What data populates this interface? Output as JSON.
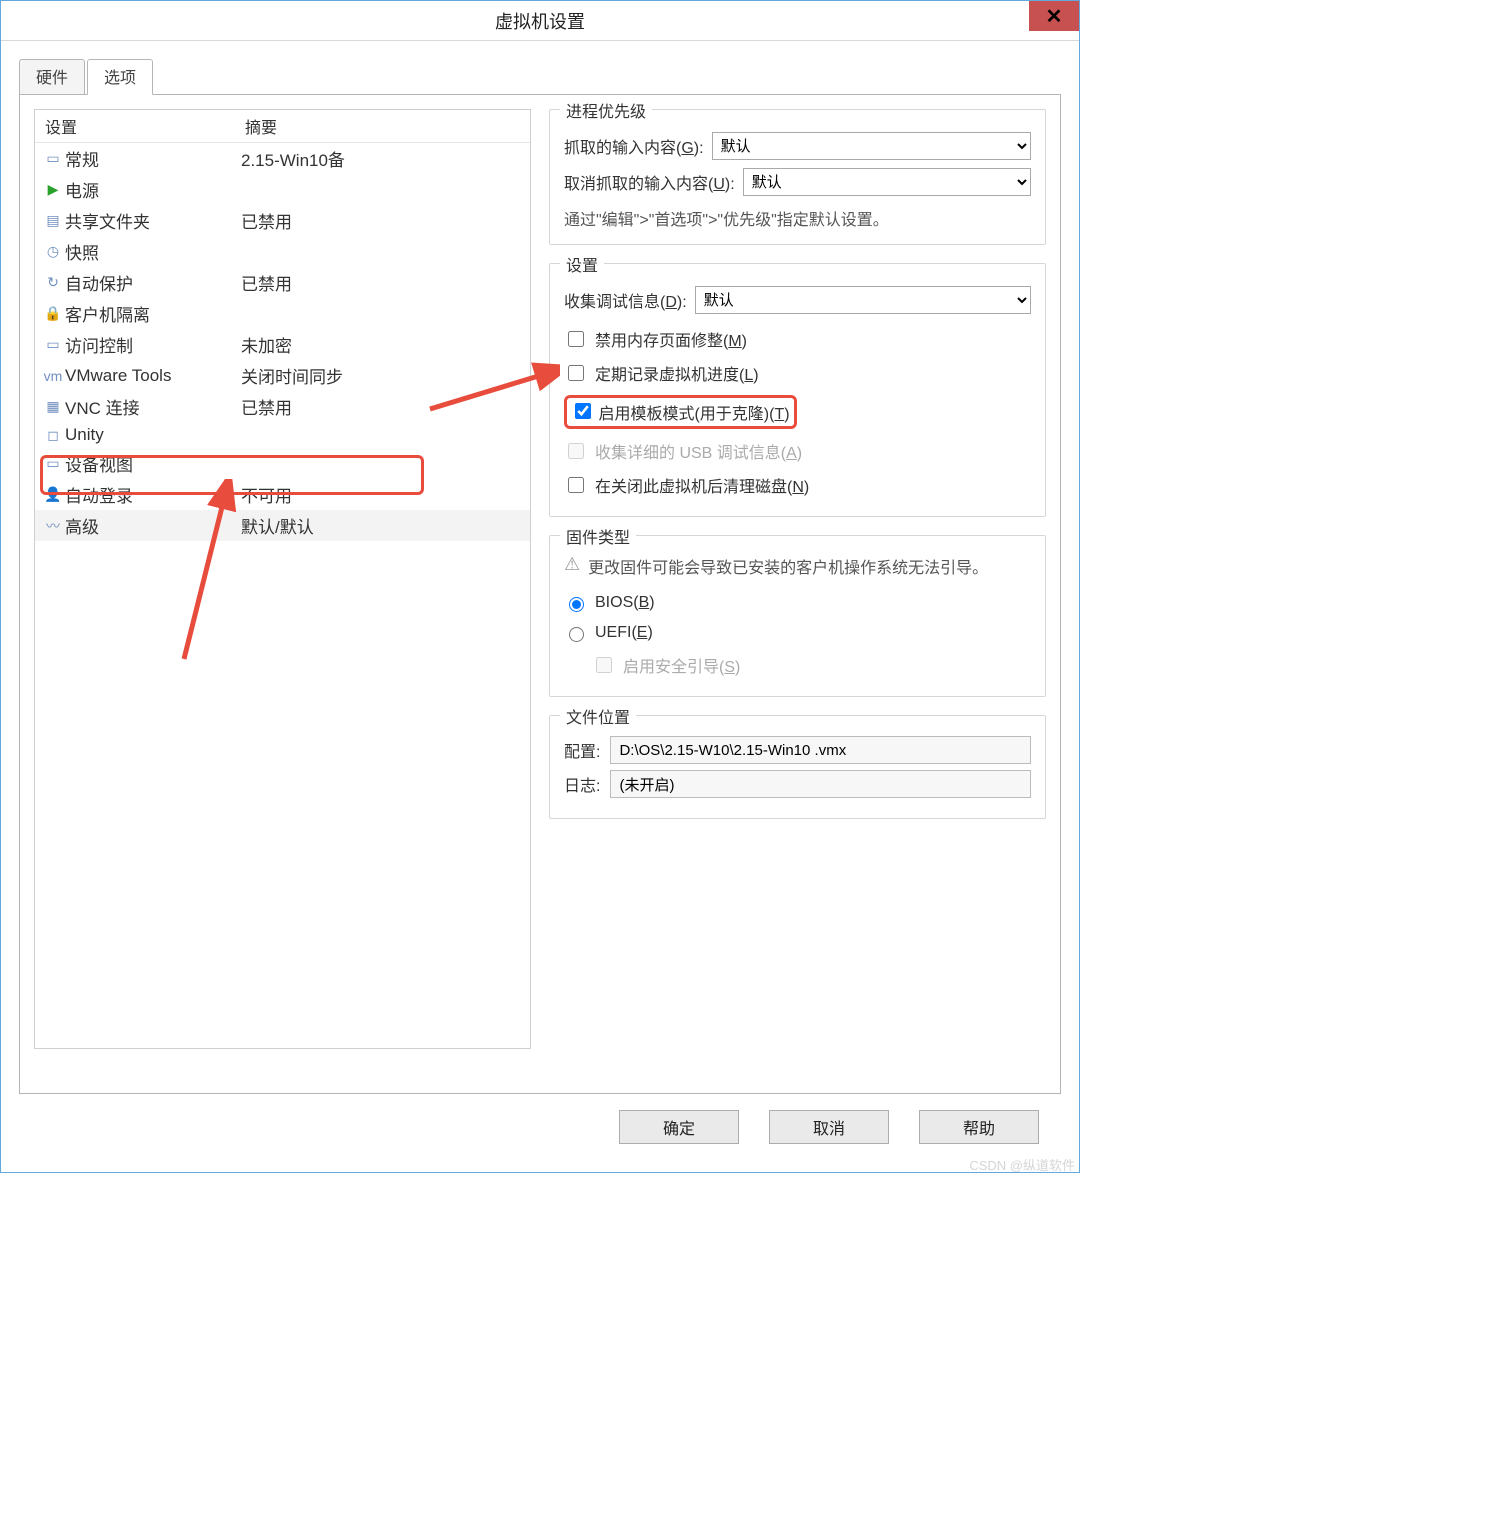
{
  "title": "虚拟机设置",
  "tabs": {
    "hardware": "硬件",
    "options": "选项"
  },
  "list": {
    "head": {
      "setting": "设置",
      "summary": "摘要"
    },
    "rows": [
      {
        "ic": "▭",
        "name": "常规",
        "summary": "2.15-Win10备"
      },
      {
        "ic": "▶",
        "name": "电源",
        "summary": "",
        "iconColor": "#2aa12a"
      },
      {
        "ic": "▤",
        "name": "共享文件夹",
        "summary": "已禁用"
      },
      {
        "ic": "◷",
        "name": "快照",
        "summary": ""
      },
      {
        "ic": "↻",
        "name": "自动保护",
        "summary": "已禁用"
      },
      {
        "ic": "🔒",
        "name": "客户机隔离",
        "summary": ""
      },
      {
        "ic": "▭",
        "name": "访问控制",
        "summary": "未加密"
      },
      {
        "ic": "vm",
        "name": "VMware Tools",
        "summary": "关闭时间同步"
      },
      {
        "ic": "▦",
        "name": "VNC 连接",
        "summary": "已禁用"
      },
      {
        "ic": "◻",
        "name": "Unity",
        "summary": ""
      },
      {
        "ic": "▭",
        "name": "设备视图",
        "summary": ""
      },
      {
        "ic": "👤",
        "name": "自动登录",
        "summary": "不可用"
      },
      {
        "ic": "〰",
        "name": "高级",
        "summary": "默认/默认",
        "sel": true
      }
    ]
  },
  "priority": {
    "legend": "进程优先级",
    "grabbed": "抓取的输入内容(G):",
    "ungrabbed": "取消抓取的输入内容(U):",
    "option": "默认",
    "hint": "通过\"编辑\">\"首选项\">\"优先级\"指定默认设置。"
  },
  "settings": {
    "legend": "设置",
    "debug": "收集调试信息(D):",
    "debug_opt": "默认",
    "mem": {
      "label": "禁用内存页面修整(M)",
      "chk": false
    },
    "log": {
      "label": "定期记录虚拟机进度(L)",
      "chk": false
    },
    "tpl": {
      "label": "启用模板模式(用于克隆)(T)",
      "chk": true
    },
    "usb": {
      "label": "收集详细的 USB 调试信息(A)",
      "chk": false,
      "disabled": true
    },
    "clean": {
      "label": "在关闭此虚拟机后清理磁盘(N)",
      "chk": false
    }
  },
  "firmware": {
    "legend": "固件类型",
    "warn": "更改固件可能会导致已安装的客户机操作系统无法引导。",
    "bios": "BIOS(B)",
    "uefi": "UEFI(E)",
    "secure": "启用安全引导(S)"
  },
  "fileloc": {
    "legend": "文件位置",
    "config": "配置:",
    "config_val": "D:\\OS\\2.15-W10\\2.15-Win10 .vmx",
    "log": "日志:",
    "log_val": "(未开启)"
  },
  "buttons": {
    "ok": "确定",
    "cancel": "取消",
    "help": "帮助"
  },
  "watermark": "CSDN @纵道软件"
}
